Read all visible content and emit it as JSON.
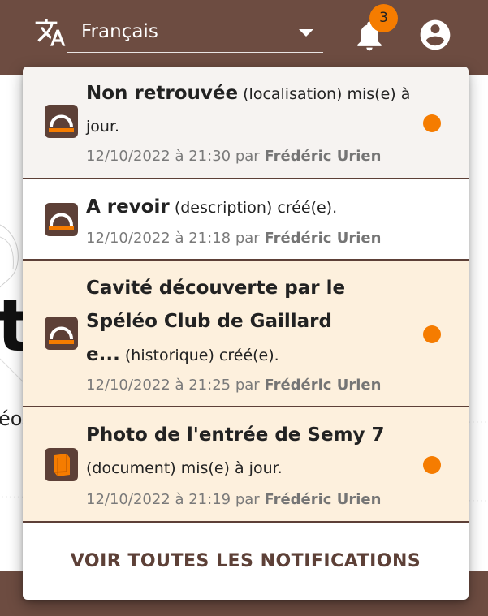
{
  "header": {
    "language_icon": "translate-icon",
    "language_value": "Français",
    "notification_icon": "bell-icon",
    "notification_count": "3",
    "account_icon": "account-circle-icon",
    "background_color": "#6d4c41",
    "badge_color": "#f57c00"
  },
  "background": {
    "letter": "t",
    "text": "éo"
  },
  "notifications": {
    "items": [
      {
        "icon": "cave-entrance-icon",
        "title": "Non retrouvée",
        "type": "(localisation)",
        "action": "mis(e) à jour.",
        "date": "12/10/2022 à 21:30",
        "by": "par",
        "author": "Frédéric Urien",
        "unread": true
      },
      {
        "icon": "cave-entrance-icon",
        "title": "A revoir",
        "type": "(description)",
        "action": "créé(e).",
        "date": "12/10/2022 à 21:18",
        "by": "par",
        "author": "Frédéric Urien",
        "unread": false
      },
      {
        "icon": "cave-entrance-icon",
        "title": "Cavité découverte par le Spéléo Club de Gaillard e...",
        "type": "(historique)",
        "action": "créé(e).",
        "date": "12/10/2022 à 21:25",
        "by": "par",
        "author": "Frédéric Urien",
        "unread": true
      },
      {
        "icon": "document-book-icon",
        "title": "Photo de l'entrée de Semy 7",
        "type": "(document)",
        "action": "mis(e) à jour.",
        "date": "12/10/2022 à 21:19",
        "by": "par",
        "author": "Frédéric Urien",
        "unread": true
      }
    ],
    "see_all_label": "VOIR TOUTES LES NOTIFICATIONS",
    "unread_dot_color": "#f57c00",
    "accent_color": "#5d4037"
  }
}
